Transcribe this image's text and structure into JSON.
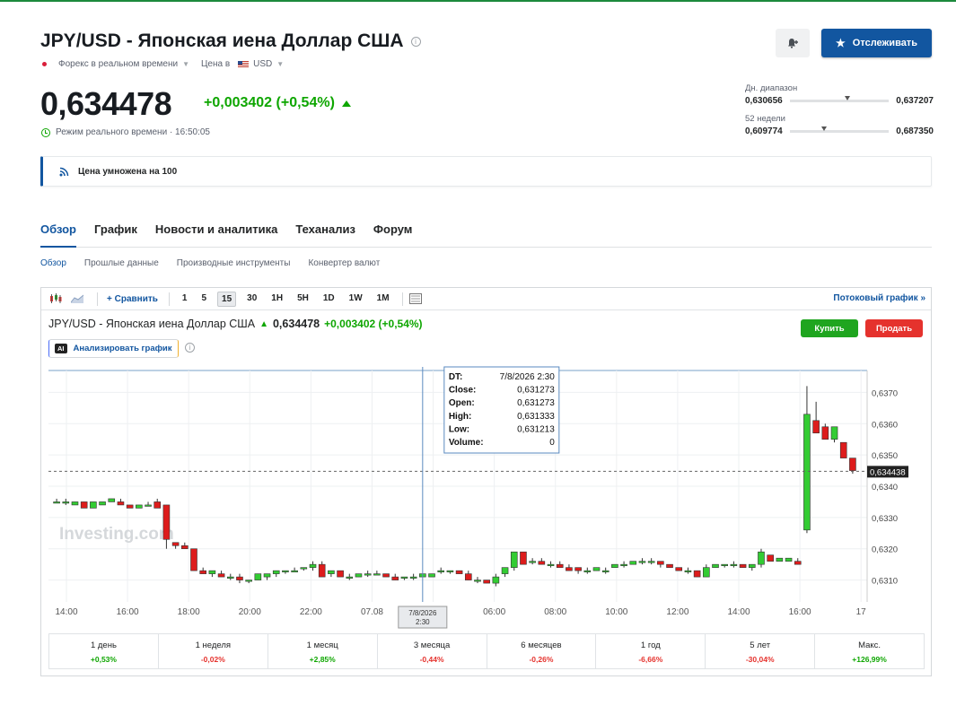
{
  "header": {
    "title": "JPY/USD - Японская иена Доллар США",
    "market": "Форекс в реальном времени",
    "currency_label": "Цена в",
    "currency": "USD",
    "follow_label": "Отслеживать"
  },
  "quote": {
    "price": "0,634478",
    "change": "+0,003402 (+0,54%)",
    "realtime": "Режим реального времени · 16:50:05"
  },
  "ranges": {
    "day_label": "Дн. диапазон",
    "day_low": "0,630656",
    "day_high": "0,637207",
    "day_position": 0.55,
    "week52_label": "52 недели",
    "week52_low": "0,609774",
    "week52_high": "0,687350",
    "week52_position": 0.32
  },
  "notice": "Цена умножена на 100",
  "tabs": [
    "Обзор",
    "График",
    "Новости и аналитика",
    "Теханализ",
    "Форум"
  ],
  "subtabs": [
    "Обзор",
    "Прошлые данные",
    "Производные инструменты",
    "Конвертер валют"
  ],
  "toolbar": {
    "compare": "Сравнить",
    "intervals": [
      "1",
      "5",
      "15",
      "30",
      "1H",
      "5H",
      "1D",
      "1W",
      "1M"
    ],
    "selected_interval": "15",
    "stream": "Потоковый график »"
  },
  "chart_header": {
    "title": "JPY/USD - Японская иена Доллар США",
    "price": "0,634478",
    "change": "+0,003402 (+0,54%)",
    "buy": "Купить",
    "sell": "Продать",
    "analyze": "Анализировать график",
    "ai_badge": "AI"
  },
  "tooltip": {
    "rows": [
      [
        "DT:",
        "7/8/2026 2:30"
      ],
      [
        "Close:",
        "0,631273"
      ],
      [
        "Open:",
        "0,631273"
      ],
      [
        "High:",
        "0,631333"
      ],
      [
        "Low:",
        "0,631213"
      ],
      [
        "Volume:",
        "0"
      ]
    ],
    "x_label_1": "7/8/2026",
    "x_label_2": "2:30"
  },
  "watermark": "Investing.com",
  "chart_data": {
    "type": "candlestick",
    "ylim": [
      0.6303,
      0.6377
    ],
    "y_ticks": [
      "0,6370",
      "0,6360",
      "0,6350",
      "0,6340",
      "0,6330",
      "0,6320",
      "0,6310"
    ],
    "y_tick_values": [
      0.637,
      0.636,
      0.635,
      0.634,
      0.633,
      0.632,
      0.631
    ],
    "x_ticks": [
      "14:00",
      "16:00",
      "18:00",
      "20:00",
      "22:00",
      "07.08",
      "04:00",
      "06:00",
      "08:00",
      "10:00",
      "12:00",
      "14:00",
      "16:00",
      "17"
    ],
    "last_price": 0.634478,
    "last_price_label": "0,634438",
    "candles": [
      [
        0.6335,
        0.6336,
        0.6335,
        0.6335
      ],
      [
        0.6335,
        0.6336,
        0.6334,
        0.6335
      ],
      [
        0.6334,
        0.6335,
        0.6334,
        0.6335
      ],
      [
        0.6335,
        0.6335,
        0.6333,
        0.6333
      ],
      [
        0.6333,
        0.6335,
        0.6333,
        0.6335
      ],
      [
        0.6334,
        0.6335,
        0.6334,
        0.6335
      ],
      [
        0.6335,
        0.6336,
        0.6335,
        0.6336
      ],
      [
        0.6335,
        0.6336,
        0.6334,
        0.6334
      ],
      [
        0.6334,
        0.6334,
        0.6333,
        0.6333
      ],
      [
        0.6333,
        0.6334,
        0.6333,
        0.6334
      ],
      [
        0.6334,
        0.6335,
        0.6334,
        0.6334
      ],
      [
        0.6335,
        0.6336,
        0.6333,
        0.6333
      ],
      [
        0.6334,
        0.6334,
        0.632,
        0.6323
      ],
      [
        0.6322,
        0.6322,
        0.632,
        0.6321
      ],
      [
        0.6321,
        0.6322,
        0.632,
        0.632
      ],
      [
        0.632,
        0.632,
        0.6313,
        0.6313
      ],
      [
        0.6313,
        0.6314,
        0.6312,
        0.6312
      ],
      [
        0.6312,
        0.6313,
        0.6311,
        0.6313
      ],
      [
        0.6312,
        0.6313,
        0.6311,
        0.6311
      ],
      [
        0.6311,
        0.6312,
        0.631,
        0.6311
      ],
      [
        0.6311,
        0.6312,
        0.6309,
        0.631
      ],
      [
        0.631,
        0.631,
        0.6309,
        0.631
      ],
      [
        0.631,
        0.6312,
        0.631,
        0.6312
      ],
      [
        0.6311,
        0.6312,
        0.631,
        0.6312
      ],
      [
        0.6312,
        0.6313,
        0.6311,
        0.6313
      ],
      [
        0.6313,
        0.6313,
        0.6312,
        0.6313
      ],
      [
        0.6313,
        0.6314,
        0.6313,
        0.6313
      ],
      [
        0.6314,
        0.6314,
        0.6313,
        0.6314
      ],
      [
        0.6314,
        0.6316,
        0.6313,
        0.6315
      ],
      [
        0.6315,
        0.6316,
        0.6311,
        0.6311
      ],
      [
        0.6312,
        0.6313,
        0.6311,
        0.6313
      ],
      [
        0.6313,
        0.6313,
        0.6311,
        0.6311
      ],
      [
        0.6311,
        0.6312,
        0.631,
        0.6311
      ],
      [
        0.6311,
        0.6312,
        0.6311,
        0.6312
      ],
      [
        0.6312,
        0.6313,
        0.6311,
        0.6312
      ],
      [
        0.6312,
        0.6313,
        0.6312,
        0.6312
      ],
      [
        0.6312,
        0.6312,
        0.6311,
        0.6311
      ],
      [
        0.6311,
        0.6312,
        0.631,
        0.631
      ],
      [
        0.6311,
        0.6311,
        0.631,
        0.6311
      ],
      [
        0.6311,
        0.6312,
        0.631,
        0.6311
      ],
      [
        0.6311,
        0.6312,
        0.6311,
        0.6312
      ],
      [
        0.6311,
        0.6312,
        0.6311,
        0.6312
      ],
      [
        0.6313,
        0.6314,
        0.6312,
        0.6313
      ],
      [
        0.6313,
        0.6313,
        0.6312,
        0.6313
      ],
      [
        0.6313,
        0.6313,
        0.6312,
        0.6312
      ],
      [
        0.6312,
        0.6313,
        0.631,
        0.631
      ],
      [
        0.631,
        0.6311,
        0.6309,
        0.631
      ],
      [
        0.631,
        0.631,
        0.6309,
        0.6309
      ],
      [
        0.6309,
        0.6312,
        0.6308,
        0.6311
      ],
      [
        0.6312,
        0.6314,
        0.6311,
        0.6314
      ],
      [
        0.6314,
        0.6319,
        0.6313,
        0.6319
      ],
      [
        0.6319,
        0.6319,
        0.6315,
        0.6315
      ],
      [
        0.6316,
        0.6317,
        0.6315,
        0.6316
      ],
      [
        0.6316,
        0.6317,
        0.6315,
        0.6315
      ],
      [
        0.6315,
        0.6316,
        0.6314,
        0.6315
      ],
      [
        0.6315,
        0.6316,
        0.6314,
        0.6314
      ],
      [
        0.6314,
        0.6315,
        0.6313,
        0.6313
      ],
      [
        0.6314,
        0.6314,
        0.6312,
        0.6313
      ],
      [
        0.6313,
        0.6314,
        0.6312,
        0.6313
      ],
      [
        0.6313,
        0.6314,
        0.6313,
        0.6314
      ],
      [
        0.6313,
        0.6314,
        0.6312,
        0.6313
      ],
      [
        0.6314,
        0.6315,
        0.6314,
        0.6315
      ],
      [
        0.6315,
        0.6316,
        0.6314,
        0.6315
      ],
      [
        0.6315,
        0.6316,
        0.6315,
        0.6316
      ],
      [
        0.6316,
        0.6317,
        0.6315,
        0.6316
      ],
      [
        0.6316,
        0.6317,
        0.6315,
        0.6316
      ],
      [
        0.6316,
        0.6316,
        0.6314,
        0.6315
      ],
      [
        0.6315,
        0.6315,
        0.6314,
        0.6314
      ],
      [
        0.6314,
        0.6314,
        0.6313,
        0.6313
      ],
      [
        0.6313,
        0.6314,
        0.6312,
        0.6313
      ],
      [
        0.6313,
        0.6313,
        0.6311,
        0.6311
      ],
      [
        0.6311,
        0.6315,
        0.6311,
        0.6314
      ],
      [
        0.6314,
        0.6315,
        0.6314,
        0.6315
      ],
      [
        0.6315,
        0.6315,
        0.6314,
        0.6315
      ],
      [
        0.6315,
        0.6316,
        0.6314,
        0.6315
      ],
      [
        0.6315,
        0.6315,
        0.6314,
        0.6314
      ],
      [
        0.6314,
        0.6315,
        0.6313,
        0.6315
      ],
      [
        0.6315,
        0.632,
        0.6314,
        0.6319
      ],
      [
        0.6318,
        0.6318,
        0.6316,
        0.6316
      ],
      [
        0.6316,
        0.6317,
        0.6316,
        0.6317
      ],
      [
        0.6316,
        0.6317,
        0.6316,
        0.6317
      ],
      [
        0.6316,
        0.6317,
        0.6315,
        0.6315
      ],
      [
        0.6326,
        0.6372,
        0.6325,
        0.6363
      ],
      [
        0.6361,
        0.6367,
        0.6357,
        0.6357
      ],
      [
        0.6359,
        0.636,
        0.6355,
        0.6355
      ],
      [
        0.6355,
        0.6359,
        0.6354,
        0.6359
      ],
      [
        0.6354,
        0.6354,
        0.6349,
        0.6349
      ],
      [
        0.6349,
        0.6349,
        0.6344,
        0.6345
      ]
    ]
  },
  "periods": [
    {
      "label": "1 день",
      "value": "+0,53%",
      "dir": "pos"
    },
    {
      "label": "1 неделя",
      "value": "-0,02%",
      "dir": "neg"
    },
    {
      "label": "1 месяц",
      "value": "+2,85%",
      "dir": "pos"
    },
    {
      "label": "3 месяца",
      "value": "-0,44%",
      "dir": "neg"
    },
    {
      "label": "6 месяцев",
      "value": "-0,26%",
      "dir": "neg"
    },
    {
      "label": "1 год",
      "value": "-6,66%",
      "dir": "neg"
    },
    {
      "label": "5 лет",
      "value": "-30,04%",
      "dir": "neg"
    },
    {
      "label": "Макс.",
      "value": "+126,99%",
      "dir": "pos"
    }
  ]
}
